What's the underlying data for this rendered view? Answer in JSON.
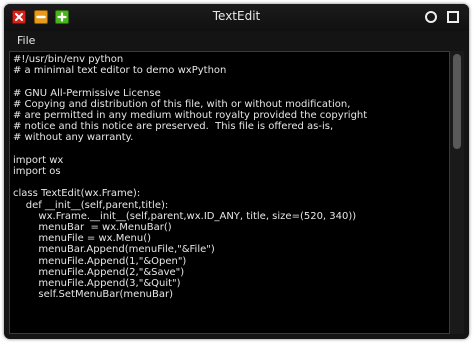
{
  "window": {
    "title": "TextEdit"
  },
  "menu": {
    "items": [
      "File"
    ]
  },
  "icons": {
    "close": "close-icon",
    "minimize": "minimize-icon",
    "maximize": "plus-icon",
    "circle": "circle-icon",
    "square": "square-icon"
  },
  "colors": {
    "close": "#d8231c",
    "minimize": "#e89a1a",
    "maximize": "#49b51c",
    "background": "#000000",
    "text": "#e6e6e6"
  },
  "editor": {
    "text": "#!/usr/bin/env python\n# a minimal text editor to demo wxPython\n\n# GNU All-Permissive License\n# Copying and distribution of this file, with or without modification,\n# are permitted in any medium without royalty provided the copyright\n# notice and this notice are preserved.  This file is offered as-is,\n# without any warranty.\n\nimport wx\nimport os\n\nclass TextEdit(wx.Frame):\n    def __init__(self,parent,title):\n        wx.Frame.__init__(self,parent,wx.ID_ANY, title, size=(520, 340))\n        menuBar  = wx.MenuBar()\n        menuFile = wx.Menu()\n        menuBar.Append(menuFile,\"&File\")\n        menuFile.Append(1,\"&Open\")\n        menuFile.Append(2,\"&Save\")\n        menuFile.Append(3,\"&Quit\")\n        self.SetMenuBar(menuBar)"
  }
}
